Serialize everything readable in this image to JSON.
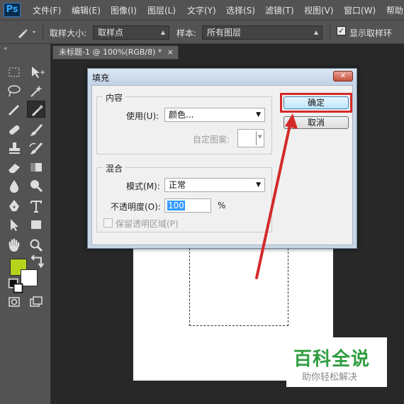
{
  "app": {
    "logo": "Ps"
  },
  "menu": {
    "items": [
      "文件(F)",
      "编辑(E)",
      "图像(I)",
      "图层(L)",
      "文字(Y)",
      "选择(S)",
      "滤镜(T)",
      "视图(V)",
      "窗口(W)",
      "帮助"
    ]
  },
  "options": {
    "sample_size_label": "取样大小:",
    "sample_size_value": "取样点",
    "sample_label": "样本:",
    "sample_value": "所有图层",
    "show_ring_label": "显示取样环",
    "show_ring_checked": true
  },
  "toolbox": {
    "collapse_icon": "«",
    "foreground_color": "#b7d21d",
    "background_color": "#ffffff",
    "selected_tool": "eyedropper"
  },
  "document": {
    "tab_title": "未标题-1 @ 100%(RGB/8) *",
    "close_glyph": "×"
  },
  "dialog": {
    "title": "填充",
    "close_glyph": "✕",
    "content_group": "内容",
    "use_label": "使用(U):",
    "use_value": "颜色...",
    "custom_pattern_label": "自定图案:",
    "blend_group": "混合",
    "mode_label": "模式(M):",
    "mode_value": "正常",
    "opacity_label": "不透明度(O):",
    "opacity_value": "100",
    "opacity_unit": "%",
    "preserve_label": "保留透明区域(P)",
    "preserve_checked": false,
    "ok_label": "确定",
    "cancel_label": "取消"
  },
  "annotation": {
    "color": "#d42a2a"
  },
  "watermark": {
    "title": "百科全说",
    "subtitle": "助你轻松解决"
  }
}
